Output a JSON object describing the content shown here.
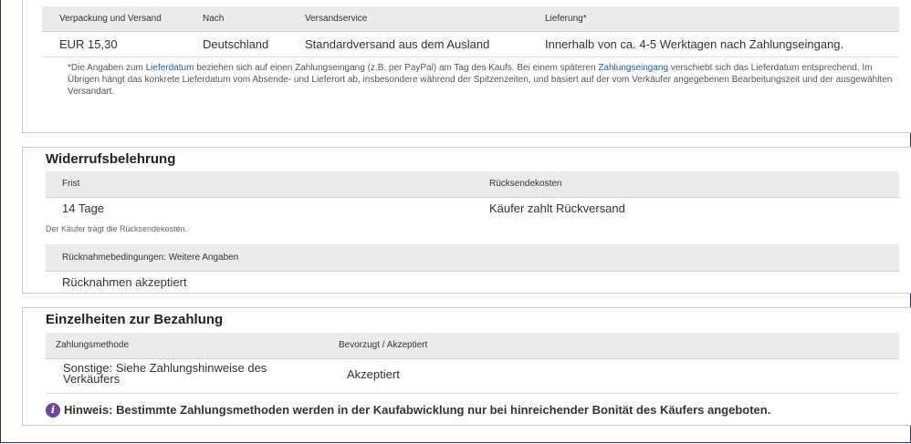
{
  "shipping": {
    "headers": [
      "Verpackung und Versand",
      "Nach",
      "Versandservice",
      "Lieferung*"
    ],
    "row": {
      "price": "EUR 15,30",
      "to": "Deutschland",
      "service": "Standardversand aus dem Ausland",
      "delivery": "Innerhalb von ca. 4-5 Werktagen nach Zahlungseingang."
    },
    "note": {
      "part1": "*Die Angaben zum ",
      "link1": "Lieferdatum",
      "part2": " beziehen sich auf einen Zahlungseingang (z.B. per PayPal) am Tag des Kaufs. Bei einem späteren ",
      "link2": "Zahlungseingang",
      "part3": " verschiebt sich das Lieferdatum entsprechend. Im Übrigen hängt das konkrete Lieferdatum vom Absende- und Lieferort ab, insbesondere während der Spitzenzeiten, und basiert auf der vom Verkäufer angegebenen Bearbeitungszeit und der ausgewählten Versandart."
    }
  },
  "returns": {
    "title": "Widerrufsbelehrung",
    "headers": [
      "Frist",
      "Rücksendekosten"
    ],
    "row": {
      "period": "14 Tage",
      "cost": "Käufer zahlt Rückversand"
    },
    "note": "Der Käufer trägt die Rücksendekosten.",
    "conditions_header": "Rücknahmebedingungen: Weitere Angaben",
    "conditions_value": "Rücknahmen akzeptiert"
  },
  "payment": {
    "title": "Einzelheiten zur Bezahlung",
    "headers": [
      "Zahlungsmethode",
      "Bevorzugt / Akzeptiert"
    ],
    "row": {
      "method": "Sonstige: Siehe Zahlungshinweise des Verkäufers",
      "status": "Akzeptiert"
    },
    "hint": "Hinweis: Bestimmte Zahlungsmethoden werden in der Kaufabwicklung nur bei hinreichender Bonität des Käufers angeboten.",
    "icon": "info-icon"
  }
}
